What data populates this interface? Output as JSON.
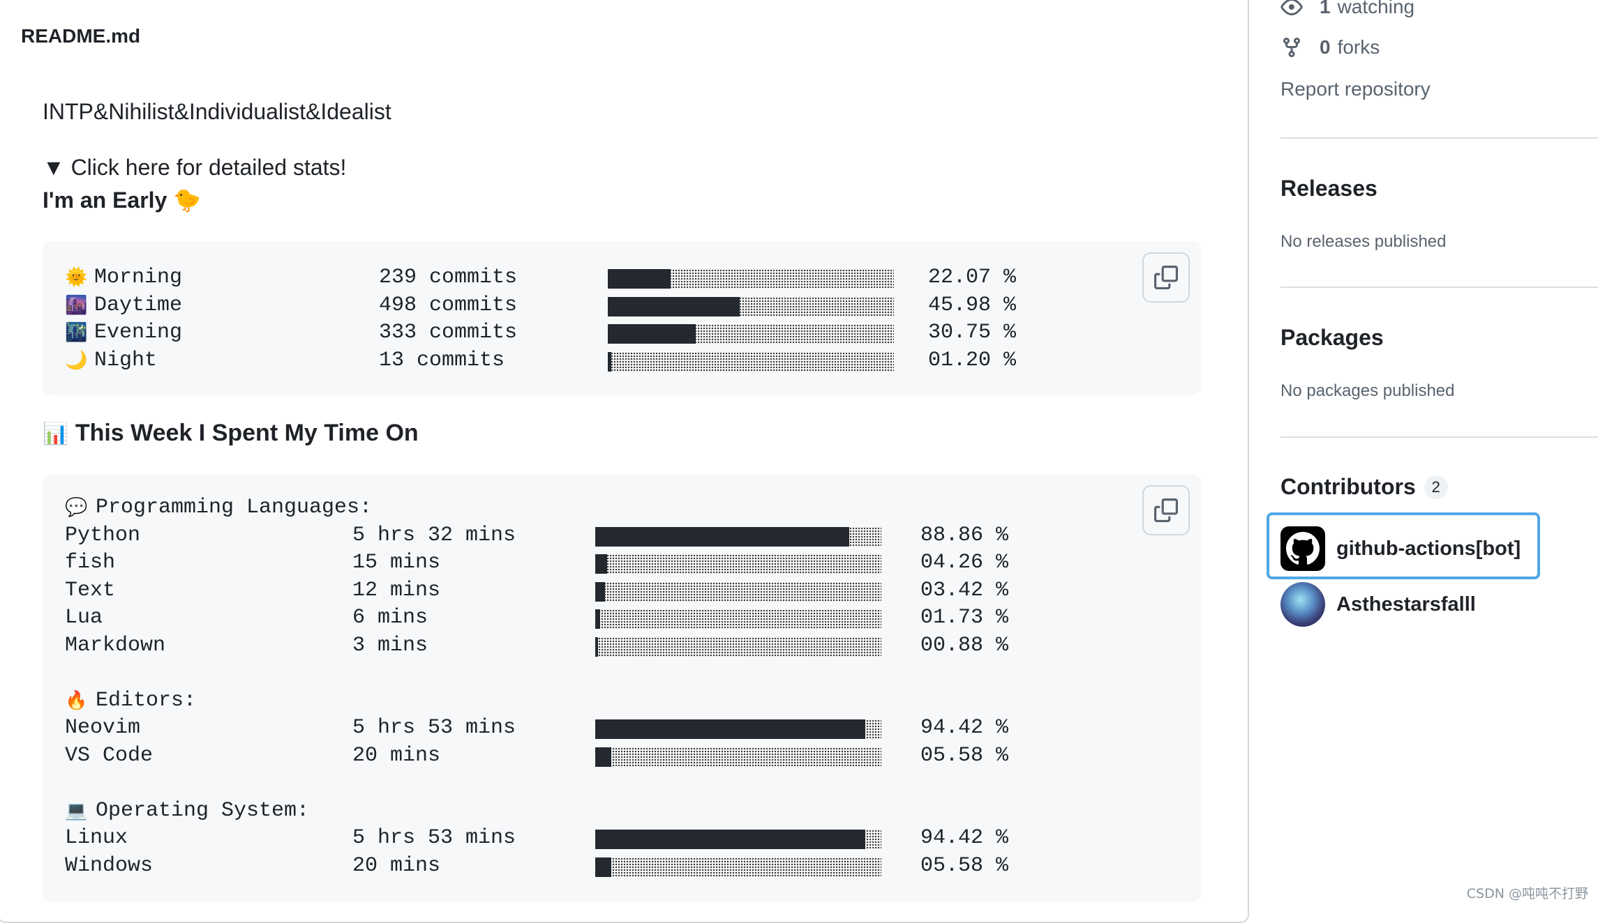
{
  "readme": {
    "filename": "README.md",
    "bio": "INTP&Nihilist&Individualist&Idealist",
    "details_summary": "▼ Click here for detailed stats!",
    "early_line": "I'm an Early",
    "early_emoji": "🐤"
  },
  "commit_stats": [
    {
      "emoji": "🌞",
      "label": "Morning",
      "amount": "239 commits",
      "fill": 0.2207,
      "percent": "22.07 %"
    },
    {
      "emoji": "🌆",
      "label": "Daytime",
      "amount": "498 commits",
      "fill": 0.4598,
      "percent": "45.98 %"
    },
    {
      "emoji": "🌃",
      "label": "Evening",
      "amount": "333 commits",
      "fill": 0.3075,
      "percent": "30.75 %"
    },
    {
      "emoji": "🌙",
      "label": "Night",
      "amount": "13 commits",
      "fill": 0.012,
      "percent": "01.20 %"
    }
  ],
  "week_heading": {
    "emoji": "📊",
    "text": "This Week I Spent My Time On"
  },
  "week_stats": [
    {
      "kind": "header",
      "emoji": "💬",
      "label": "Programming Languages:"
    },
    {
      "kind": "item",
      "label": "Python",
      "amount": "5 hrs 32 mins",
      "fill": 0.8886,
      "percent": "88.86 %"
    },
    {
      "kind": "item",
      "label": "fish",
      "amount": "15 mins",
      "fill": 0.0426,
      "percent": "04.26 %"
    },
    {
      "kind": "item",
      "label": "Text",
      "amount": "12 mins",
      "fill": 0.0342,
      "percent": "03.42 %"
    },
    {
      "kind": "item",
      "label": "Lua",
      "amount": "6 mins",
      "fill": 0.0173,
      "percent": "01.73 %"
    },
    {
      "kind": "item",
      "label": "Markdown",
      "amount": "3 mins",
      "fill": 0.0088,
      "percent": "00.88 %"
    },
    {
      "kind": "blank"
    },
    {
      "kind": "header",
      "emoji": "🔥",
      "label": "Editors:"
    },
    {
      "kind": "item",
      "label": "Neovim",
      "amount": "5 hrs 53 mins",
      "fill": 0.9442,
      "percent": "94.42 %"
    },
    {
      "kind": "item",
      "label": "VS Code",
      "amount": "20 mins",
      "fill": 0.0558,
      "percent": "05.58 %"
    },
    {
      "kind": "blank"
    },
    {
      "kind": "header",
      "emoji": "💻",
      "label": "Operating System:"
    },
    {
      "kind": "item",
      "label": "Linux",
      "amount": "5 hrs 53 mins",
      "fill": 0.9442,
      "percent": "94.42 %"
    },
    {
      "kind": "item",
      "label": "Windows",
      "amount": "20 mins",
      "fill": 0.0558,
      "percent": "05.58 %"
    }
  ],
  "sidebar": {
    "watching_count": "1",
    "watching_label": "watching",
    "forks_count": "0",
    "forks_label": "forks",
    "report_label": "Report repository",
    "releases_heading": "Releases",
    "releases_empty": "No releases published",
    "packages_heading": "Packages",
    "packages_empty": "No packages published",
    "contributors_heading": "Contributors",
    "contributors_count": "2",
    "contributors": [
      {
        "name": "github-actions[bot]",
        "avatar": "github-mark-icon"
      },
      {
        "name": "Asthestarsfalll",
        "avatar": "user-avatar"
      }
    ]
  },
  "watermark": "CSDN @吨吨不打野",
  "colors": {
    "bar_fill": "#24292f",
    "focus_ring": "#4fa8e8",
    "muted_text": "#59636e"
  }
}
